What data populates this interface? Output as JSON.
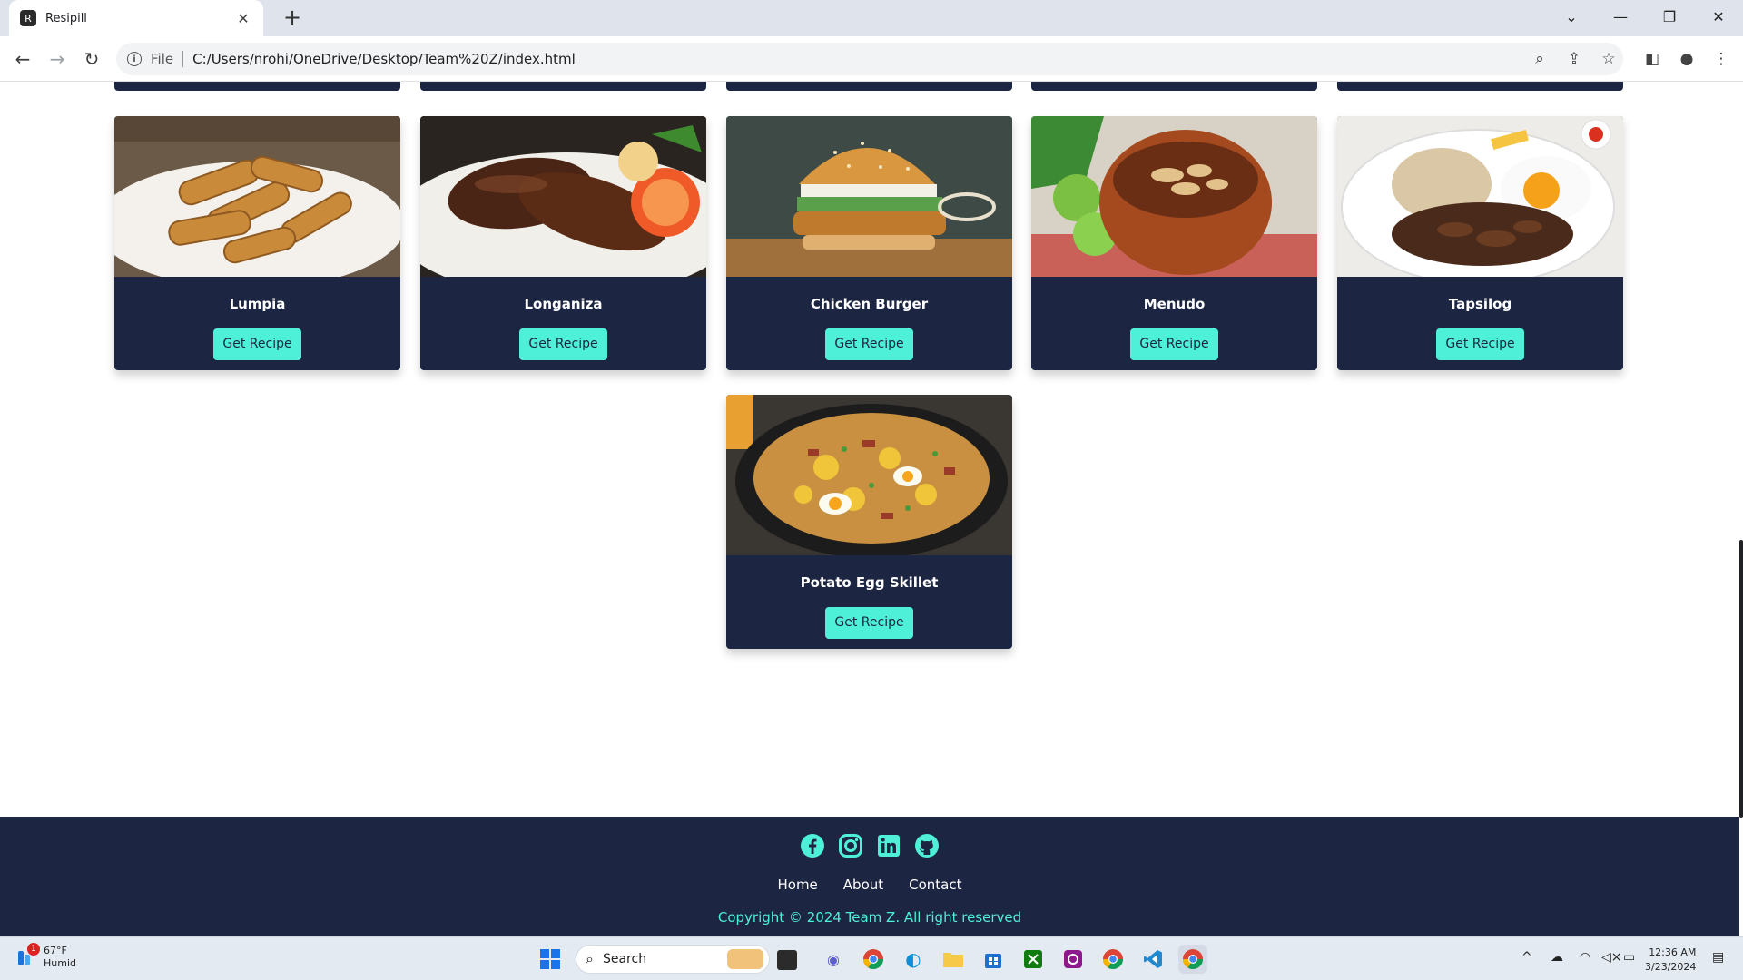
{
  "browser": {
    "tab_title": "Resipill",
    "url_scheme": "File",
    "url": "C:/Users/nrohi/OneDrive/Desktop/Team%20Z/index.html"
  },
  "recipes": [
    {
      "name": "Lumpia",
      "button": "Get Recipe"
    },
    {
      "name": "Longaniza",
      "button": "Get Recipe"
    },
    {
      "name": "Chicken Burger",
      "button": "Get Recipe"
    },
    {
      "name": "Menudo",
      "button": "Get Recipe"
    },
    {
      "name": "Tapsilog",
      "button": "Get Recipe"
    },
    {
      "name": "Potato Egg Skillet",
      "button": "Get Recipe"
    }
  ],
  "footer": {
    "socials": [
      "facebook-icon",
      "instagram-icon",
      "linkedin-icon",
      "github-icon"
    ],
    "links": [
      "Home",
      "About",
      "Contact"
    ],
    "copyright": "Copyright © 2024 Team Z. All right reserved"
  },
  "taskbar": {
    "weather_temp": "67°F",
    "weather_desc": "Humid",
    "weather_badge": "1",
    "search_placeholder": "Search",
    "time": "12:36 AM",
    "date": "3/23/2024"
  },
  "colors": {
    "card_bg": "#1c2541",
    "accent": "#4ef0d8"
  }
}
